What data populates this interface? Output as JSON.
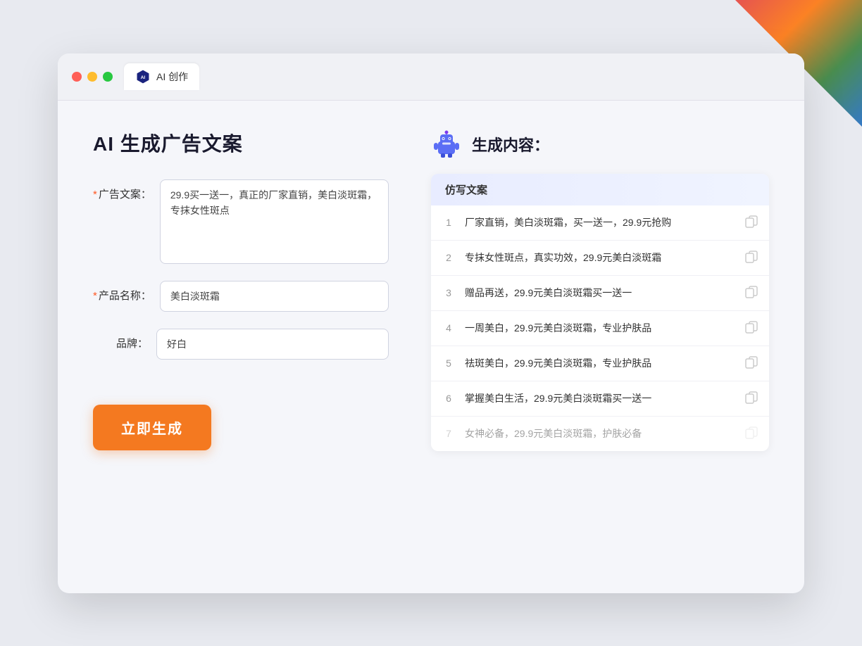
{
  "window": {
    "tab_label": "AI 创作",
    "controls": {
      "close": "close",
      "minimize": "minimize",
      "maximize": "maximize"
    }
  },
  "left_panel": {
    "title": "AI 生成广告文案",
    "form": {
      "ad_copy_label": "广告文案：",
      "ad_copy_required": "*",
      "ad_copy_value": "29.9买一送一，真正的厂家直销，美白淡斑霜，专抹女性斑点",
      "product_name_label": "产品名称：",
      "product_name_required": "*",
      "product_name_value": "美白淡斑霜",
      "brand_label": "品牌：",
      "brand_value": "好白"
    },
    "generate_button": "立即生成"
  },
  "right_panel": {
    "title": "生成内容：",
    "table_header": "仿写文案",
    "results": [
      {
        "num": "1",
        "text": "厂家直销，美白淡斑霜，买一送一，29.9元抢购",
        "dimmed": false
      },
      {
        "num": "2",
        "text": "专抹女性斑点，真实功效，29.9元美白淡斑霜",
        "dimmed": false
      },
      {
        "num": "3",
        "text": "赠品再送，29.9元美白淡斑霜买一送一",
        "dimmed": false
      },
      {
        "num": "4",
        "text": "一周美白，29.9元美白淡斑霜，专业护肤品",
        "dimmed": false
      },
      {
        "num": "5",
        "text": "祛斑美白，29.9元美白淡斑霜，专业护肤品",
        "dimmed": false
      },
      {
        "num": "6",
        "text": "掌握美白生活，29.9元美白淡斑霜买一送一",
        "dimmed": false
      },
      {
        "num": "7",
        "text": "女神必备，29.9元美白淡斑霜，护肤必备",
        "dimmed": true
      }
    ]
  }
}
